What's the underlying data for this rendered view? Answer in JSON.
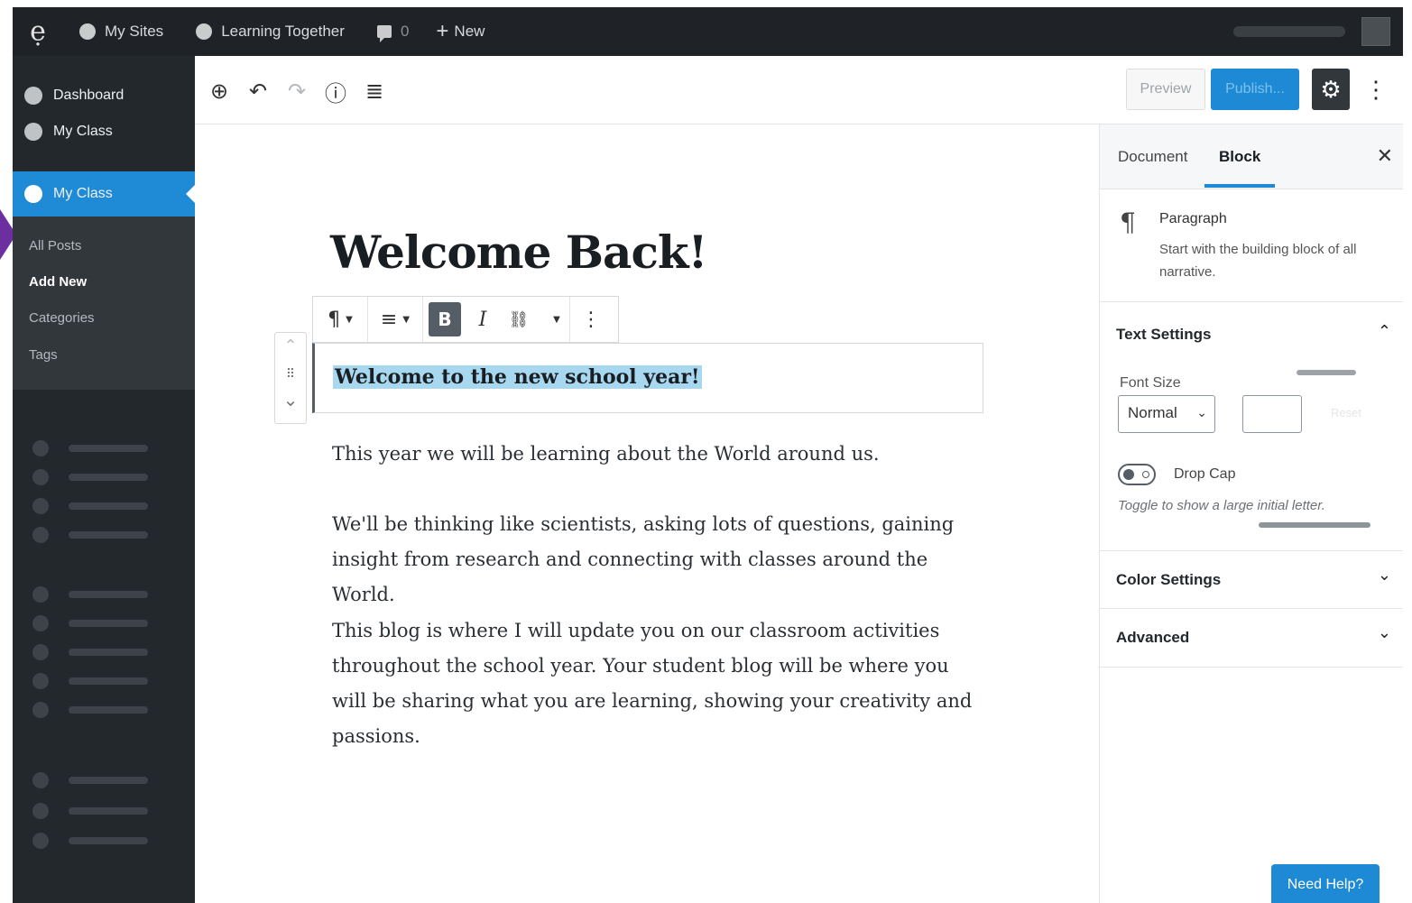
{
  "adminbar": {
    "logo_glyph": "ẹ",
    "my_sites": "My Sites",
    "site_name": "Learning Together",
    "comments_count": "0",
    "new_label": "New"
  },
  "sidebar": {
    "dashboard": "Dashboard",
    "my_class": "My Class",
    "active_item": "My Class",
    "submenu": [
      "All Posts",
      "Add New",
      "Categories",
      "Tags"
    ]
  },
  "toolbar": {
    "add_icon": "⊕",
    "undo_icon": "↶",
    "redo_icon": "↷",
    "info_icon": "ⓘ",
    "outline_icon": "≣",
    "preview_label": "Preview",
    "publish_label": "Publish...",
    "settings_icon": "⚙",
    "more_icon": "⋮"
  },
  "editor": {
    "title": "Welcome Back!",
    "block_toolbar": {
      "paragraph_icon": "¶",
      "align_icon": "≡",
      "bold_label": "B",
      "italic_label": "I",
      "link_icon": "🔗",
      "more_icon": "⋮"
    },
    "mover": {
      "up": "⌃",
      "drag": "⠿",
      "down": "⌄"
    },
    "selected_text": "Welcome to the new school year!",
    "paragraphs": [
      "This year we will be learning about the World around us.",
      "We'll be thinking like scientists, asking lots of questions, gaining insight from research and connecting with classes around the World.",
      "This blog is where I will update you on our classroom activities throughout the school year.  Your student blog will be where you will be sharing what you are learning, showing your creativity and passions."
    ]
  },
  "panel": {
    "tab_document": "Document",
    "tab_block": "Block",
    "close_icon": "✕",
    "block_icon": "¶",
    "block_name": "Paragraph",
    "block_description": "Start with the building block of all narrative.",
    "text_settings": "Text Settings",
    "font_size_label": "Font Size",
    "font_size_value": "Normal",
    "reset_label": "Reset",
    "drop_cap_label": "Drop Cap",
    "drop_cap_help": "Toggle to show a large initial letter.",
    "color_settings": "Color Settings",
    "advanced": "Advanced",
    "chevron_up": "⌃",
    "chevron_down": "⌄",
    "need_help": "Need Help?"
  },
  "colors": {
    "admin_bar": "#1f2327",
    "sidebar": "#23282d",
    "accent_blue": "#1e8ad6",
    "highlight": "#a8d8f0",
    "purple_arrow": "#6b2fa0"
  }
}
